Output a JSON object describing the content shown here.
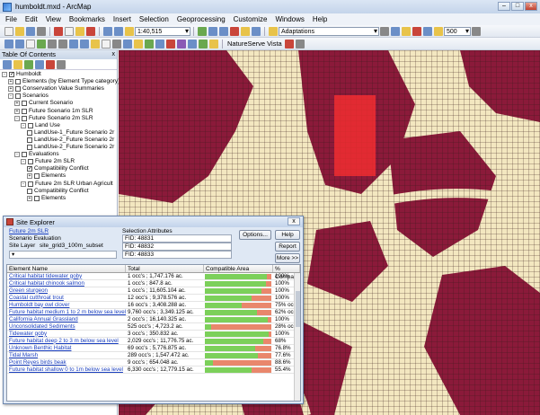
{
  "window": {
    "title": "humboldt.mxd - ArcMap",
    "minimize": "–",
    "maximize": "□",
    "close": "x"
  },
  "menu": [
    "File",
    "Edit",
    "View",
    "Bookmarks",
    "Insert",
    "Selection",
    "Geoprocessing",
    "Customize",
    "Windows",
    "Help"
  ],
  "toolbar": {
    "scale": "1:40,515",
    "adaptations": "Adaptations",
    "zoom_value": "500",
    "naturserve": "NatureServe Vista"
  },
  "toc": {
    "title": "Table Of Contents",
    "close": "x",
    "nodes": [
      {
        "label": "Humboldt",
        "depth": 0,
        "pm": "-",
        "cb": "✓"
      },
      {
        "label": "Elements (by Element Type category)",
        "depth": 1,
        "pm": "+",
        "cb": ""
      },
      {
        "label": "Conservation Value Summaries",
        "depth": 1,
        "pm": "+",
        "cb": ""
      },
      {
        "label": "Scenarios",
        "depth": 1,
        "pm": "-",
        "cb": ""
      },
      {
        "label": "Current Scenario",
        "depth": 2,
        "pm": "+",
        "cb": ""
      },
      {
        "label": "Future Scenario 1m SLR",
        "depth": 2,
        "pm": "+",
        "cb": ""
      },
      {
        "label": "Future Scenario 2m SLR",
        "depth": 2,
        "pm": "-",
        "cb": ""
      },
      {
        "label": "Land Use",
        "depth": 3,
        "pm": "-",
        "cb": ""
      },
      {
        "label": "LandUse-1_Future Scenario 2r",
        "depth": 4,
        "pm": "",
        "cb": ""
      },
      {
        "label": "LandUse-2_Future Scenario 2r",
        "depth": 4,
        "pm": "",
        "cb": ""
      },
      {
        "label": "LandUse-2_Future Scenario 2r",
        "depth": 4,
        "pm": "",
        "cb": ""
      },
      {
        "label": "Evaluations",
        "depth": 2,
        "pm": "-",
        "cb": ""
      },
      {
        "label": "Future 2m SLR",
        "depth": 3,
        "pm": "-",
        "cb": ""
      },
      {
        "label": "Compatibility Conflict",
        "depth": 4,
        "pm": "",
        "cb": "✓"
      },
      {
        "label": "Elements",
        "depth": 4,
        "pm": "+",
        "cb": ""
      },
      {
        "label": "Future 2m SLR Urban Agricult",
        "depth": 3,
        "pm": "-",
        "cb": ""
      },
      {
        "label": "Compatibility Conflict",
        "depth": 4,
        "pm": "",
        "cb": ""
      },
      {
        "label": "Elements",
        "depth": 4,
        "pm": "+",
        "cb": ""
      }
    ]
  },
  "dialog": {
    "title": "Site Explorer",
    "close": "x",
    "scenario_link": "Future 2m SLR",
    "scenario_eval": "Scenario Evaluation",
    "site_layer_label": "Site Layer",
    "site_layer_value": "site_grid3_100m_subset",
    "sel_attr_label": "Selection Attributes",
    "fids": [
      "FID: 48831",
      "FID: 48832",
      "FID: 48833"
    ],
    "btn_options": "Options...",
    "btn_help": "Help",
    "btn_report": "Report",
    "btn_more": "More >>",
    "columns": [
      "Element Name",
      "Total",
      "Compatible Area",
      "% Compat"
    ],
    "rows": [
      {
        "name": "Critical habitat tidewater goby",
        "total": "1 occ's ; 1,747.176 ac.",
        "green": 0.93,
        "red": 0.07,
        "pct": "100%"
      },
      {
        "name": "Critical habitat chinook salmon",
        "total": "1 occ's ; 847.8 ac.",
        "green": 0.92,
        "red": 0.08,
        "pct": "100%"
      },
      {
        "name": "Green sturgeon",
        "total": "1 occ's ; 11,605.104 ac.",
        "green": 0.85,
        "red": 0.15,
        "pct": "100%"
      },
      {
        "name": "Coastal cutthroat trout",
        "total": "12 occ's ; 9,378.576 ac.",
        "green": 0.7,
        "red": 0.3,
        "pct": "100%"
      },
      {
        "name": "Humboldt bay owl clover",
        "total": "16 occ's ; 3,408.288 ac.",
        "green": 0.55,
        "red": 0.45,
        "pct": "75% occ's"
      },
      {
        "name": "Future habitat medium 1 to 2 m below sea level",
        "total": "9,760 occ's ; 3,349.125 ac.",
        "green": 0.78,
        "red": 0.22,
        "pct": "62% occ's"
      },
      {
        "name": "California Annual Grassland",
        "total": "2 occ's ; 16,140.325 ac.",
        "green": 0.95,
        "red": 0.05,
        "pct": "100%"
      },
      {
        "name": "Unconsolidated Sediments",
        "total": "525 occ's ; 4,723.2 ac.",
        "green": 0.1,
        "red": 0.9,
        "pct": "28% occ's"
      },
      {
        "name": "Tidewater goby",
        "total": "3 occ's ; 350.832 ac.",
        "green": 0.96,
        "red": 0.04,
        "pct": "100%"
      },
      {
        "name": "Future habitat deep 2 to 3 m below sea level",
        "total": "2,029 occ's ; 11,776.75 ac.",
        "green": 0.88,
        "red": 0.12,
        "pct": "68%"
      },
      {
        "name": "Unknown Benthic Habitat",
        "total": "69 occ's ; 5,776.875 ac.",
        "green": 0.75,
        "red": 0.25,
        "pct": "76.8%"
      },
      {
        "name": "Tidal Marsh",
        "total": "289 occ's ; 1,547.472 ac.",
        "green": 0.8,
        "red": 0.2,
        "pct": "77.6%"
      },
      {
        "name": "Point Reyes birds beak",
        "total": "9 occ's ; 654.048 ac.",
        "green": 0.12,
        "red": 0.88,
        "pct": "88.6%"
      },
      {
        "name": "Future habitat shallow 0 to 1m below sea level",
        "total": "6,330 occ's ; 12,779.15 ac.",
        "green": 0.7,
        "red": 0.3,
        "pct": "55.4%"
      }
    ]
  },
  "colors": {
    "green": "#7cd05a",
    "red": "#e9876c",
    "marsh": "#8b1a3a",
    "sand": "#f3e7c0",
    "highlight": "#ff3030"
  }
}
